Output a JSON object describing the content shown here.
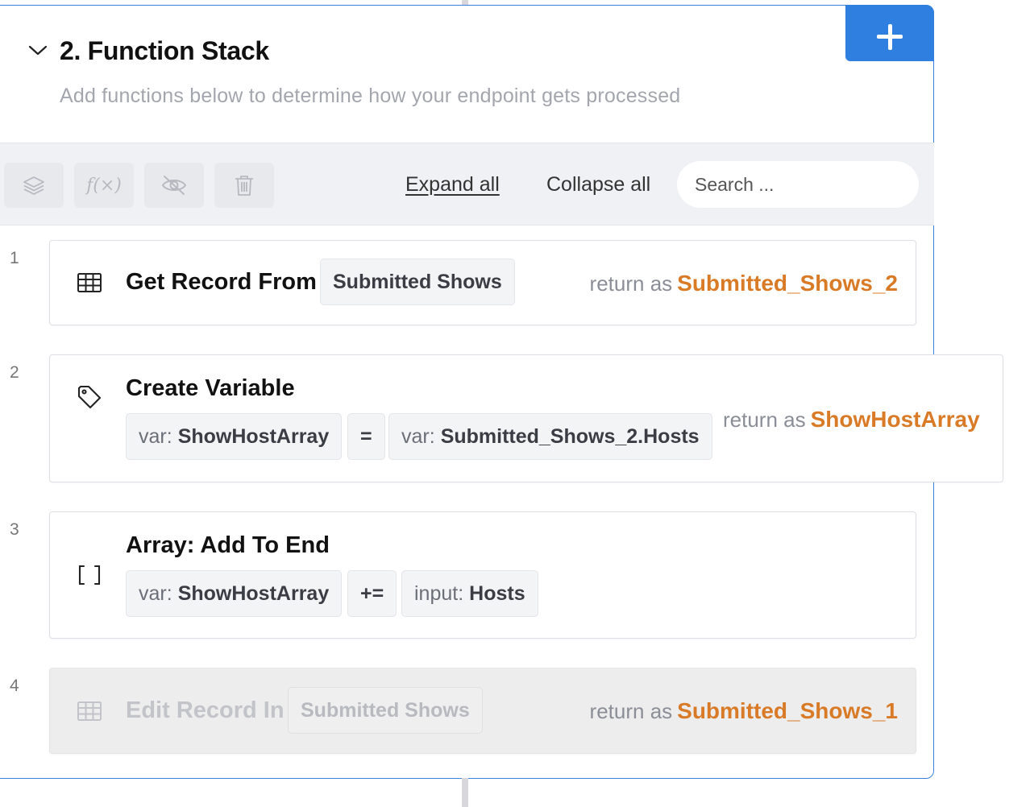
{
  "section": {
    "number_title": "2. Function Stack",
    "subtitle": "Add functions below to determine how your endpoint gets processed",
    "add_icon": "plus-icon",
    "collapse_icon": "chevron-down-icon"
  },
  "toolbar": {
    "icons": [
      "layers-icon",
      "function-icon",
      "eye-off-icon",
      "trash-icon"
    ],
    "fx_label": "f(×)",
    "expand_all": "Expand all",
    "collapse_all": "Collapse all",
    "search_placeholder": "Search ..."
  },
  "steps": [
    {
      "number": "1",
      "icon": "table-icon",
      "title": "Get Record From",
      "table": "Submitted Shows",
      "return_label": "return as",
      "return_var": "Submitted_Shows_2"
    },
    {
      "number": "2",
      "icon": "tag-icon",
      "title": "Create Variable",
      "left_prefix": "var:",
      "left_value": "ShowHostArray",
      "operator": "=",
      "right_prefix": "var:",
      "right_value": "Submitted_Shows_2.Hosts",
      "return_label": "return as",
      "return_var": "ShowHostArray"
    },
    {
      "number": "3",
      "icon": "brackets-icon",
      "title": "Array: Add To End",
      "left_prefix": "var:",
      "left_value": "ShowHostArray",
      "operator": "+=",
      "right_prefix": "input:",
      "right_value": "Hosts"
    },
    {
      "number": "4",
      "icon": "table-icon",
      "title": "Edit Record In",
      "table": "Submitted Shows",
      "return_label": "return as",
      "return_var": "Submitted_Shows_1",
      "disabled": true
    }
  ],
  "colors": {
    "accent": "#2f7fe0",
    "return_var": "#d97a26",
    "toolbar_bg": "#eff1f4"
  }
}
